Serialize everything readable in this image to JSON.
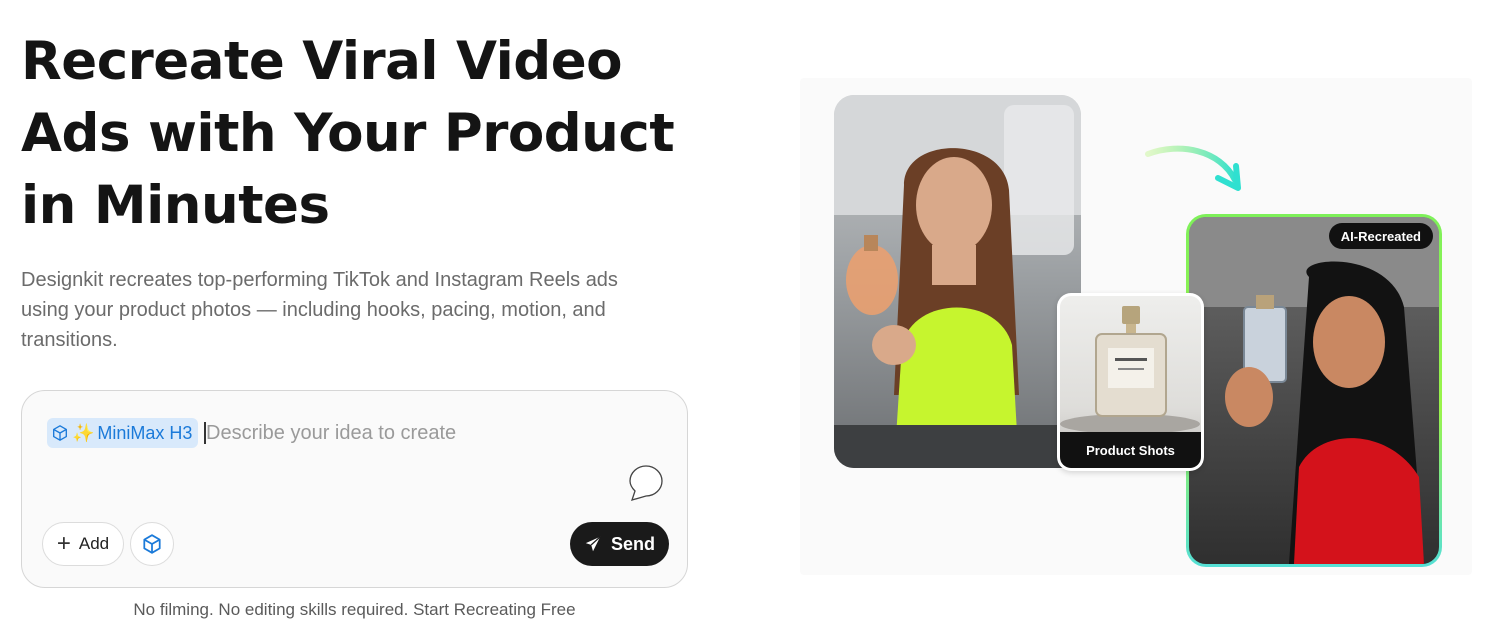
{
  "hero": {
    "title_lines": [
      "Recreate Viral Video",
      "Ads with Your Product",
      "in Minutes"
    ],
    "description_lines": [
      "Designkit recreates top-performing TikTok and Instagram Reels ads",
      "using your product photos — including hooks, pacing, motion, and",
      "transitions."
    ]
  },
  "prompt": {
    "model_chip_label": "MiniMax H3",
    "placeholder": "Describe your idea to create",
    "add_label": "Add",
    "send_label": "Send",
    "footer": "No filming. No editing skills required. Start Recreating Free"
  },
  "showcase": {
    "product_label": "Product Shots",
    "recreated_badge": "AI-Recreated"
  },
  "colors": {
    "accent_blue": "#1b7ad9",
    "chip_bg": "#d8e9fb",
    "send_bg": "#1a1a1a",
    "border_green": "#7ef15a",
    "border_cyan": "#55e0d6"
  },
  "icons": [
    "cube-icon",
    "sparkle-icon",
    "chat-bubble-icon",
    "plus-icon",
    "send-icon",
    "curved-arrow-icon"
  ]
}
